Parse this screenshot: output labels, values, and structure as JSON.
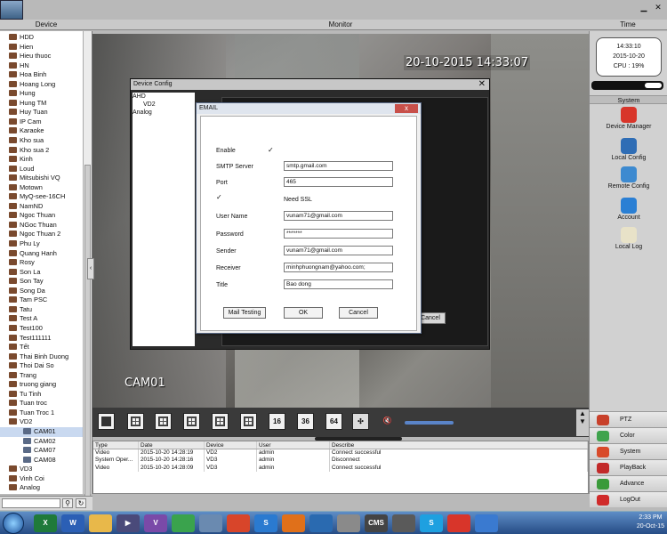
{
  "header": {
    "device": "Device",
    "monitor": "Monitor",
    "time": "Time"
  },
  "devices": [
    {
      "label": "HDD",
      "kind": "dvr"
    },
    {
      "label": "Hien",
      "kind": "dvr"
    },
    {
      "label": "Hieu thuoc",
      "kind": "dvr"
    },
    {
      "label": "HN",
      "kind": "dvr"
    },
    {
      "label": "Hoa Binh",
      "kind": "dvr"
    },
    {
      "label": "Hoang Long",
      "kind": "dvr"
    },
    {
      "label": "Hung",
      "kind": "dvr"
    },
    {
      "label": "Hung TM",
      "kind": "dvr"
    },
    {
      "label": "Huy Tuan",
      "kind": "dvr"
    },
    {
      "label": "IP Cam",
      "kind": "dvr"
    },
    {
      "label": "Karaoke",
      "kind": "dvr"
    },
    {
      "label": "Kho sua",
      "kind": "dvr"
    },
    {
      "label": "Kho sua 2",
      "kind": "dvr"
    },
    {
      "label": "Kinh",
      "kind": "dvr"
    },
    {
      "label": "Loud",
      "kind": "dvr"
    },
    {
      "label": "Mitsubishi VQ",
      "kind": "dvr"
    },
    {
      "label": "Motown",
      "kind": "dvr"
    },
    {
      "label": "MyQ-see-16CH",
      "kind": "dvr"
    },
    {
      "label": "NamND",
      "kind": "dvr"
    },
    {
      "label": "Ngoc Thuan",
      "kind": "dvr"
    },
    {
      "label": "NGoc Thuan",
      "kind": "dvr"
    },
    {
      "label": "Ngoc Thuan 2",
      "kind": "dvr"
    },
    {
      "label": "Phu Ly",
      "kind": "dvr"
    },
    {
      "label": "Quang Hanh",
      "kind": "dvr"
    },
    {
      "label": "Rosy",
      "kind": "dvr"
    },
    {
      "label": "Son La",
      "kind": "dvr"
    },
    {
      "label": "Son Tay",
      "kind": "dvr"
    },
    {
      "label": "Song  Da",
      "kind": "dvr"
    },
    {
      "label": "Tam PSC",
      "kind": "dvr"
    },
    {
      "label": "Tatu",
      "kind": "dvr"
    },
    {
      "label": "Test A",
      "kind": "dvr"
    },
    {
      "label": "Test100",
      "kind": "dvr"
    },
    {
      "label": "Test111111",
      "kind": "dvr"
    },
    {
      "label": "Tết",
      "kind": "dvr"
    },
    {
      "label": "Thai Binh Duong",
      "kind": "dvr"
    },
    {
      "label": "Thoi Dai So",
      "kind": "dvr"
    },
    {
      "label": "Trang",
      "kind": "dvr"
    },
    {
      "label": "truong giang",
      "kind": "dvr"
    },
    {
      "label": "Tu Tinh",
      "kind": "dvr"
    },
    {
      "label": "Tuan troc",
      "kind": "dvr"
    },
    {
      "label": "Tuan Troc 1",
      "kind": "dvr"
    },
    {
      "label": "VD2",
      "kind": "expanded"
    },
    {
      "label": "CAM01",
      "kind": "cam",
      "selected": true
    },
    {
      "label": "CAM02",
      "kind": "cam"
    },
    {
      "label": "CAM07",
      "kind": "cam"
    },
    {
      "label": "CAM08",
      "kind": "cam"
    },
    {
      "label": "VD3",
      "kind": "dvr"
    },
    {
      "label": "Vinh Coi",
      "kind": "dvr"
    },
    {
      "label": "Analog",
      "kind": "dvr"
    }
  ],
  "video": {
    "timestamp": "20-10-2015 14:33:07",
    "camera": "CAM01"
  },
  "device_config": {
    "title": "Device Config",
    "tree": [
      "AHD",
      "VD2",
      "Analog"
    ],
    "cancel": "Cancel"
  },
  "email_dialog": {
    "title": "EMAIL",
    "close": "x",
    "enable_label": "Enable",
    "enable_checked": "✓",
    "smtp_label": "SMTP Server",
    "smtp_value": "smtp.gmail.com",
    "port_label": "Port",
    "port_value": "465",
    "ssl_checked": "✓",
    "ssl_label": "Need SSL",
    "user_label": "User Name",
    "user_value": "vunam71@gmail.com",
    "password_label": "Password",
    "password_value": "*******",
    "sender_label": "Sender",
    "sender_value": "vunam71@gmail.com",
    "receiver_label": "Receiver",
    "receiver_value": "minhphuongnam@yahoo.com;",
    "title_label": "Title",
    "title_value": "Bao dong",
    "mail_testing": "Mail Testing",
    "ok": "OK",
    "cancel": "Cancel"
  },
  "toolbar": {
    "layout_16": "16",
    "layout_36": "36",
    "layout_64": "64"
  },
  "log": {
    "headers": [
      "Type",
      "Date",
      "Device",
      "User",
      "Describe"
    ],
    "rows": [
      [
        "Video",
        "2015-10-20 14:28:19",
        "VD2",
        "admin",
        "Connect successful"
      ],
      [
        "System Oper...",
        "2015-10-20 14:28:16",
        "VD3",
        "admin",
        "Disconnect"
      ],
      [
        "Video",
        "2015-10-20 14:28:09",
        "VD3",
        "admin",
        "Connect successful"
      ]
    ]
  },
  "clock": {
    "time": "14:33:10",
    "date": "2015-10-20",
    "cpu": "CPU : 19%"
  },
  "system_panel": {
    "header": "System",
    "items": [
      {
        "label": "Device Manager",
        "icon": "device-manager-icon",
        "color": "#d8352a"
      },
      {
        "label": "Local Config",
        "icon": "local-config-icon",
        "color": "#2f6db5"
      },
      {
        "label": "Remote Config",
        "icon": "remote-config-icon",
        "color": "#3d8ad0"
      },
      {
        "label": "Account",
        "icon": "account-icon",
        "color": "#2a7fd4"
      },
      {
        "label": "Local Log",
        "icon": "local-log-icon",
        "color": "#e8e2c8"
      }
    ]
  },
  "nav": [
    {
      "label": "PTZ",
      "icon": "ptz-icon",
      "color": "#c8402a"
    },
    {
      "label": "Color",
      "icon": "color-icon",
      "color": "#3fa34d"
    },
    {
      "label": "System",
      "icon": "system-icon",
      "color": "#d84a2a"
    },
    {
      "label": "PlayBack",
      "icon": "playback-icon",
      "color": "#c22a2a"
    },
    {
      "label": "Advance",
      "icon": "advance-icon",
      "color": "#3a9a3a"
    },
    {
      "label": "LogOut",
      "icon": "logout-icon",
      "color": "#d02a2a"
    }
  ],
  "taskbar": {
    "apps": [
      {
        "icon": "excel-icon",
        "text": "X",
        "color": "#1f7a3a"
      },
      {
        "icon": "word-icon",
        "text": "W",
        "color": "#2b5fb5"
      },
      {
        "icon": "folder-icon",
        "text": "",
        "color": "#e8b84a"
      },
      {
        "icon": "media-player-icon",
        "text": "▶",
        "color": "#4a4a7a"
      },
      {
        "icon": "viber-icon",
        "text": "V",
        "color": "#7a4aa8"
      },
      {
        "icon": "refresh-app-icon",
        "text": "",
        "color": "#3aa34d"
      },
      {
        "icon": "photos-icon",
        "text": "",
        "color": "#6a8ab0"
      },
      {
        "icon": "chrome-icon",
        "text": "",
        "color": "#d8452a"
      },
      {
        "icon": "skype-alt-icon",
        "text": "S",
        "color": "#2a7ad0"
      },
      {
        "icon": "firefox-icon",
        "text": "",
        "color": "#e0701a"
      },
      {
        "icon": "share-icon",
        "text": "",
        "color": "#2a6ab0"
      },
      {
        "icon": "camera-app-icon",
        "text": "",
        "color": "#8a8a8a"
      },
      {
        "icon": "cms-icon",
        "text": "CMS",
        "color": "#444"
      },
      {
        "icon": "network-app-icon",
        "text": "",
        "color": "#5a5a5a"
      },
      {
        "icon": "skype-icon",
        "text": "S",
        "color": "#1ea0e0"
      },
      {
        "icon": "grid-app-icon",
        "text": "",
        "color": "#d8352a"
      },
      {
        "icon": "paint-icon",
        "text": "",
        "color": "#3a7ad0"
      }
    ],
    "time": "2:33 PM",
    "date": "20-Oct-15"
  }
}
